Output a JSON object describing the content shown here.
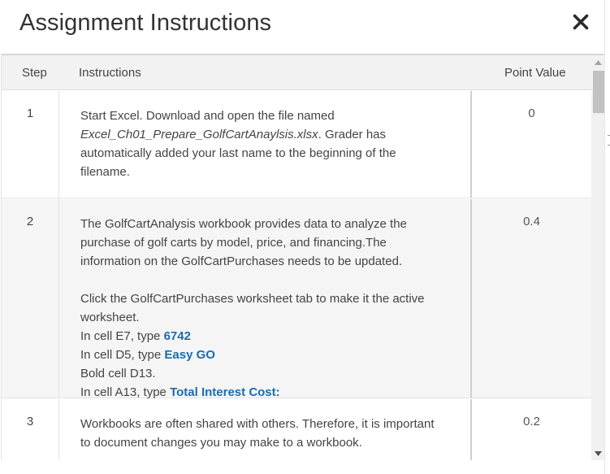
{
  "modal": {
    "title": "Assignment Instructions",
    "close_glyph": "×"
  },
  "table": {
    "headers": {
      "step": "Step",
      "instructions": "Instructions",
      "points": "Point Value"
    },
    "rows": [
      {
        "step": "1",
        "points": "0",
        "lines": [
          "Start Excel. Download and open the file named",
          "Excel_Ch01_Prepare_GolfCartAnaylsis.xlsx",
          ". Grader has",
          "automatically added your last name to the beginning of the",
          "filename."
        ]
      },
      {
        "step": "2",
        "points": "0.4",
        "lines": [
          "The GolfCartAnalysis workbook provides data to analyze the",
          "purchase of golf carts by model, price, and financing.The",
          "information on the GolfCartPurchases needs to be updated.",
          "Click the GolfCartPurchases worksheet tab to make it the active",
          "worksheet.",
          "In cell E7, type ",
          "6742",
          "In cell D5, type ",
          "Easy GO",
          "Bold cell D13.",
          "In cell A13, type ",
          "Total Interest Cost:"
        ]
      },
      {
        "step": "3",
        "points": "0.2",
        "lines": [
          "Workbooks are often shared with others. Therefore, it is important",
          "to document changes you may make to a workbook."
        ]
      }
    ]
  },
  "colors": {
    "highlight": "#1b6cb0",
    "header_bg": "#f2f2f2",
    "alt_row_bg": "#f5f5f5"
  },
  "icons": {
    "close": "close-icon",
    "scroll_up": "scroll-up-arrow-icon",
    "scroll_down": "scroll-down-arrow-icon"
  }
}
